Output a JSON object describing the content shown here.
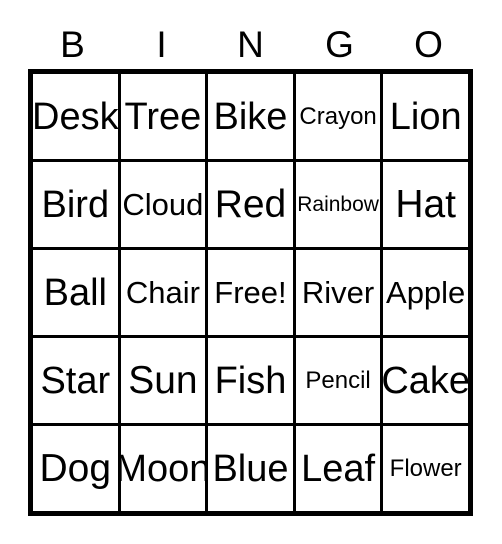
{
  "card": {
    "header": {
      "letters": [
        "B",
        "I",
        "N",
        "G",
        "O"
      ]
    },
    "grid": {
      "columns": 5,
      "rows": 5,
      "free_space": "Free!",
      "border_color": "#000000",
      "background_color": "#ffffff",
      "text_color": "#000000",
      "cells": [
        [
          {
            "label": "Desk"
          },
          {
            "label": "Tree"
          },
          {
            "label": "Bike"
          },
          {
            "label": "Crayon"
          },
          {
            "label": "Lion"
          }
        ],
        [
          {
            "label": "Bird"
          },
          {
            "label": "Cloud"
          },
          {
            "label": "Red"
          },
          {
            "label": "Rainbow"
          },
          {
            "label": "Hat"
          }
        ],
        [
          {
            "label": "Ball"
          },
          {
            "label": "Chair"
          },
          {
            "label": "Free!"
          },
          {
            "label": "River"
          },
          {
            "label": "Apple"
          }
        ],
        [
          {
            "label": "Star"
          },
          {
            "label": "Sun"
          },
          {
            "label": "Fish"
          },
          {
            "label": "Pencil"
          },
          {
            "label": "Cake"
          }
        ],
        [
          {
            "label": "Dog"
          },
          {
            "label": "Moon"
          },
          {
            "label": "Blue"
          },
          {
            "label": "Leaf"
          },
          {
            "label": "Flower"
          }
        ]
      ]
    }
  }
}
